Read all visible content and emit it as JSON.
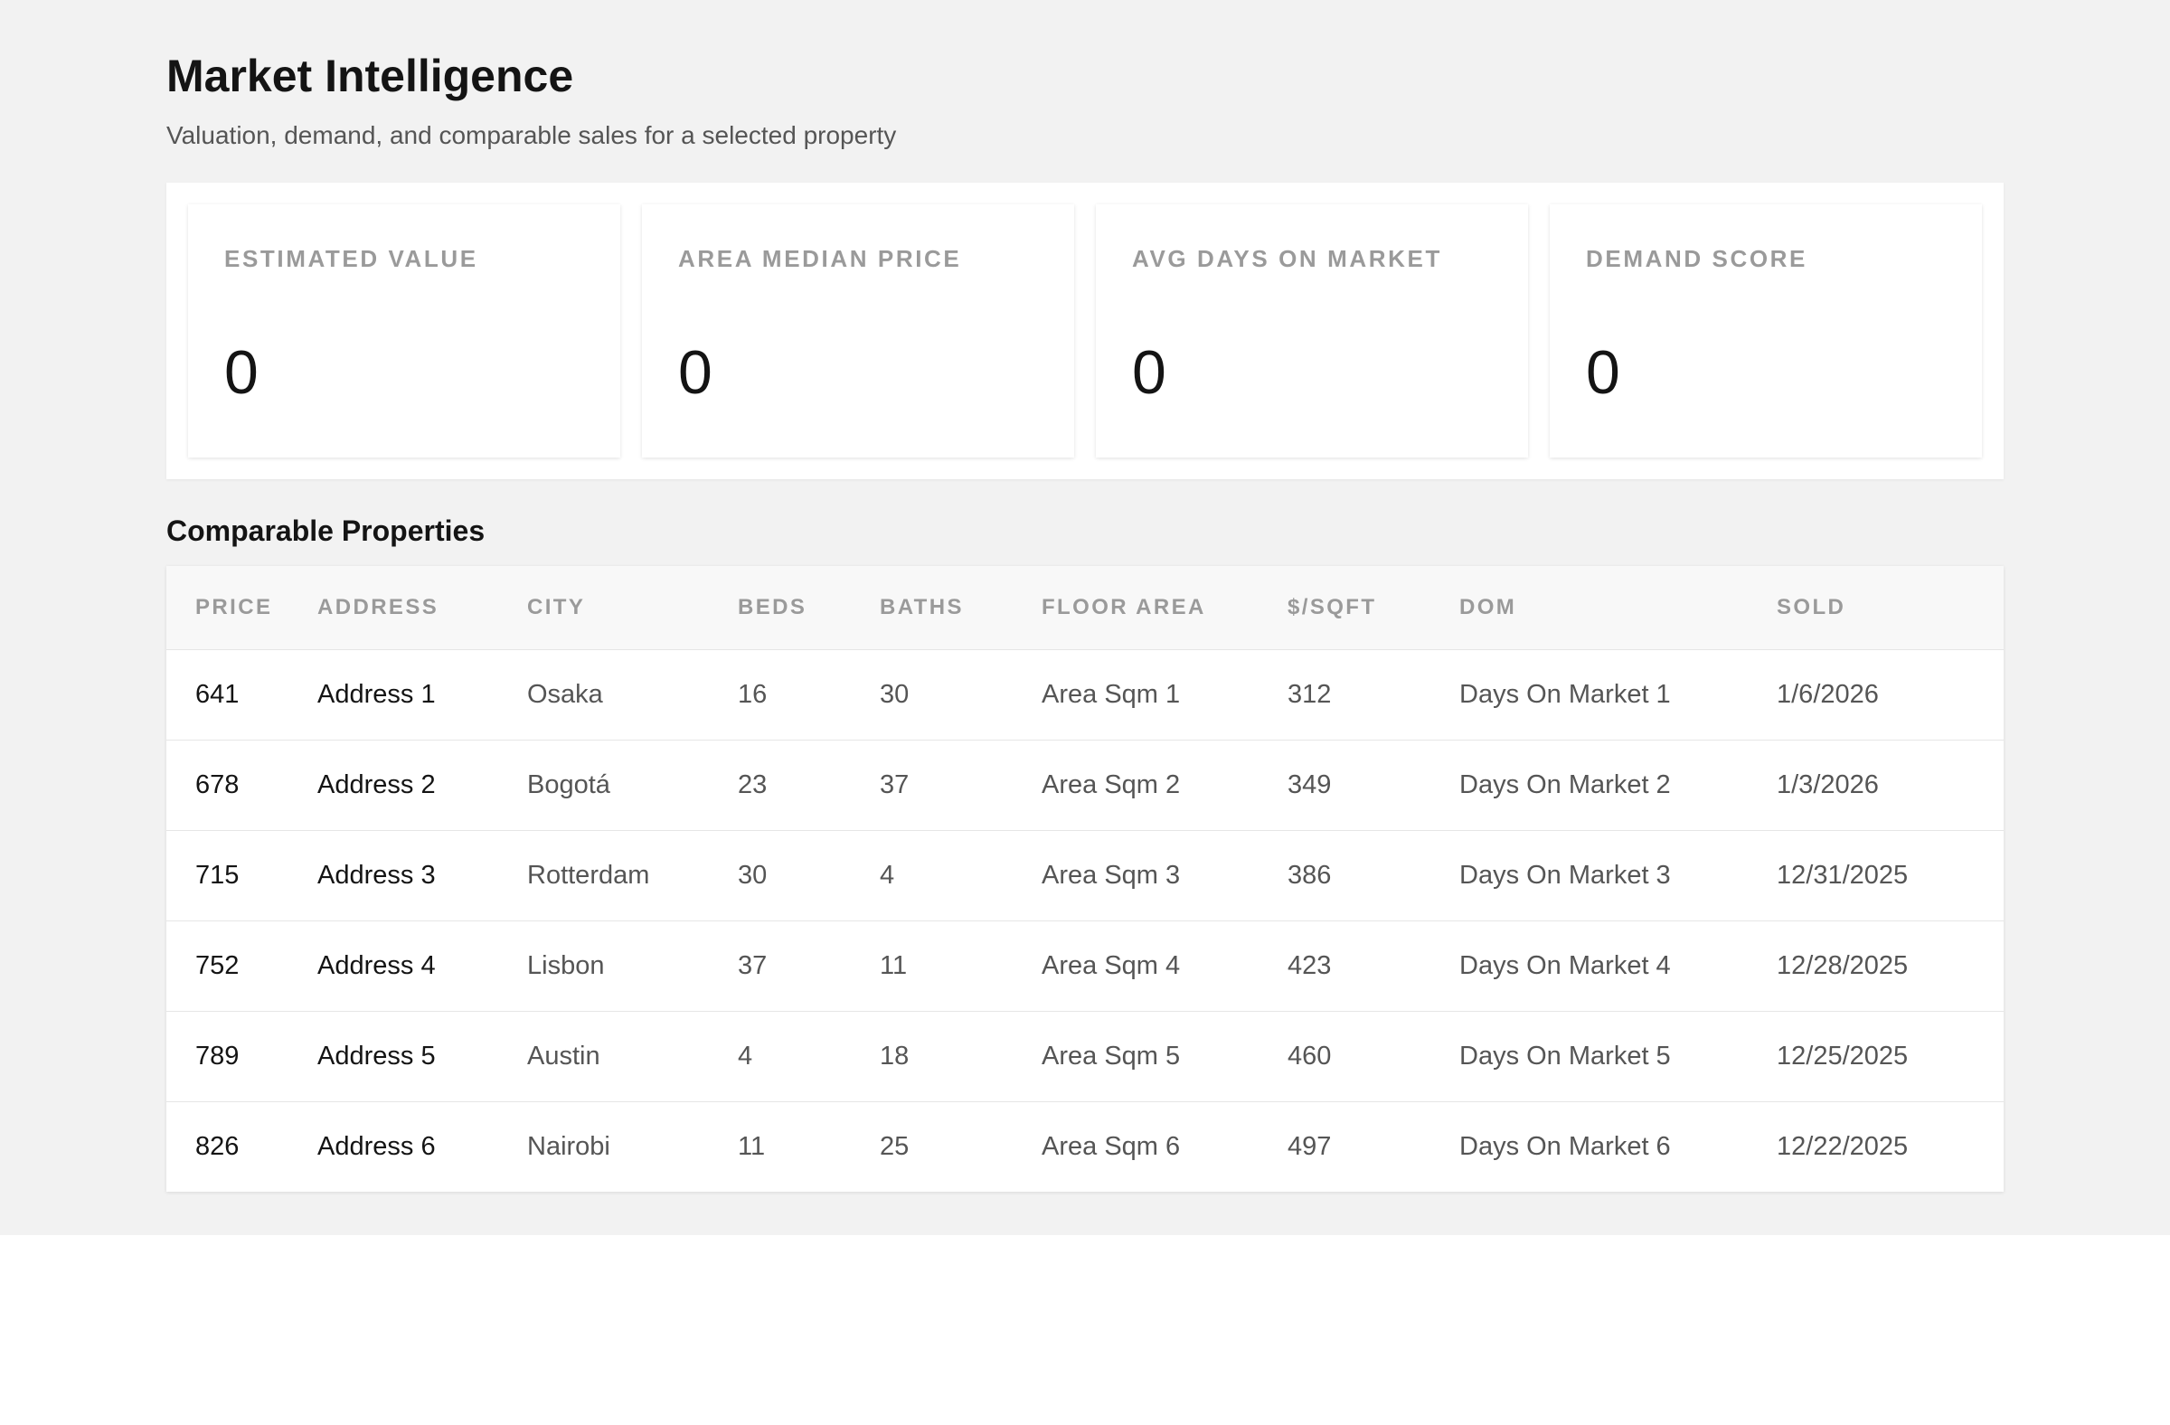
{
  "header": {
    "title": "Market Intelligence",
    "subtitle": "Valuation, demand, and comparable sales for a selected property"
  },
  "stats": [
    {
      "label": "ESTIMATED VALUE",
      "value": "0"
    },
    {
      "label": "AREA MEDIAN PRICE",
      "value": "0"
    },
    {
      "label": "AVG DAYS ON MARKET",
      "value": "0"
    },
    {
      "label": "DEMAND SCORE",
      "value": "0"
    }
  ],
  "comparables": {
    "title": "Comparable Properties",
    "columns": [
      "PRICE",
      "ADDRESS",
      "CITY",
      "BEDS",
      "BATHS",
      "FLOOR AREA",
      "$/SQFT",
      "DOM",
      "SOLD"
    ],
    "rows": [
      [
        "641",
        "Address 1",
        "Osaka",
        "16",
        "30",
        "Area Sqm 1",
        "312",
        "Days On Market 1",
        "1/6/2026"
      ],
      [
        "678",
        "Address 2",
        "Bogotá",
        "23",
        "37",
        "Area Sqm 2",
        "349",
        "Days On Market 2",
        "1/3/2026"
      ],
      [
        "715",
        "Address 3",
        "Rotterdam",
        "30",
        "4",
        "Area Sqm 3",
        "386",
        "Days On Market 3",
        "12/31/2025"
      ],
      [
        "752",
        "Address 4",
        "Lisbon",
        "37",
        "11",
        "Area Sqm 4",
        "423",
        "Days On Market 4",
        "12/28/2025"
      ],
      [
        "789",
        "Address 5",
        "Austin",
        "4",
        "18",
        "Area Sqm 5",
        "460",
        "Days On Market 5",
        "12/25/2025"
      ],
      [
        "826",
        "Address 6",
        "Nairobi",
        "11",
        "25",
        "Area Sqm 6",
        "497",
        "Days On Market 6",
        "12/22/2025"
      ]
    ]
  }
}
